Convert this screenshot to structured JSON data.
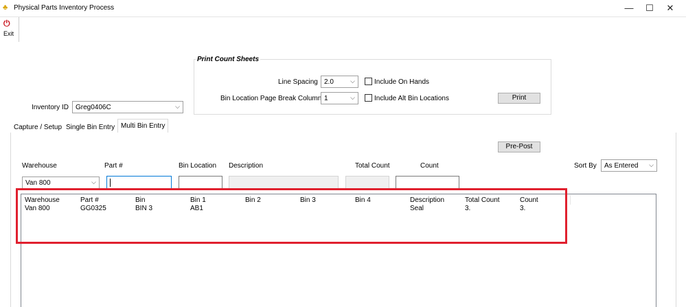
{
  "window": {
    "title": "Physical Parts Inventory Process",
    "minimize_glyph": "—",
    "maximize_glyph": "☐",
    "close_glyph": "✕"
  },
  "toolbar": {
    "exit_label": "Exit",
    "exit_icon": "exit-arrow-icon"
  },
  "header": {
    "inventory_id_label": "Inventory ID",
    "inventory_id_value": "Greg0406C"
  },
  "print_group": {
    "title": "Print Count Sheets",
    "line_spacing_label": "Line Spacing",
    "line_spacing_value": "2.0",
    "page_break_label": "Bin Location Page Break Column",
    "page_break_value": "1",
    "include_on_hands_label": "Include On Hands",
    "include_alt_bins_label": "Include Alt Bin Locations",
    "print_label": "Print"
  },
  "tabs": [
    {
      "label": "Capture / Setup"
    },
    {
      "label": "Single Bin Entry"
    },
    {
      "label": "Multi Bin Entry"
    }
  ],
  "multi_bin": {
    "prepost_label": "Pre-Post",
    "sort_by_label": "Sort By",
    "sort_by_value": "As Entered",
    "fields": {
      "warehouse_label": "Warehouse",
      "part_label": "Part #",
      "bin_location_label": "Bin Location",
      "description_label": "Description",
      "total_count_label": "Total Count",
      "count_label": "Count",
      "warehouse_value": "Van 800"
    },
    "table": {
      "columns": [
        "Warehouse",
        "Part #",
        "Bin",
        "Bin 1",
        "Bin 2",
        "Bin 3",
        "Bin 4",
        "Description",
        "Total Count",
        "Count"
      ],
      "rows": [
        [
          "Van 800",
          "GG0325",
          "BIN 3",
          "AB1",
          "",
          "",
          "",
          "Seal",
          "3.",
          "3."
        ]
      ]
    }
  },
  "colors": {
    "highlight": "#e0202e",
    "focus_border": "#0078d7"
  }
}
